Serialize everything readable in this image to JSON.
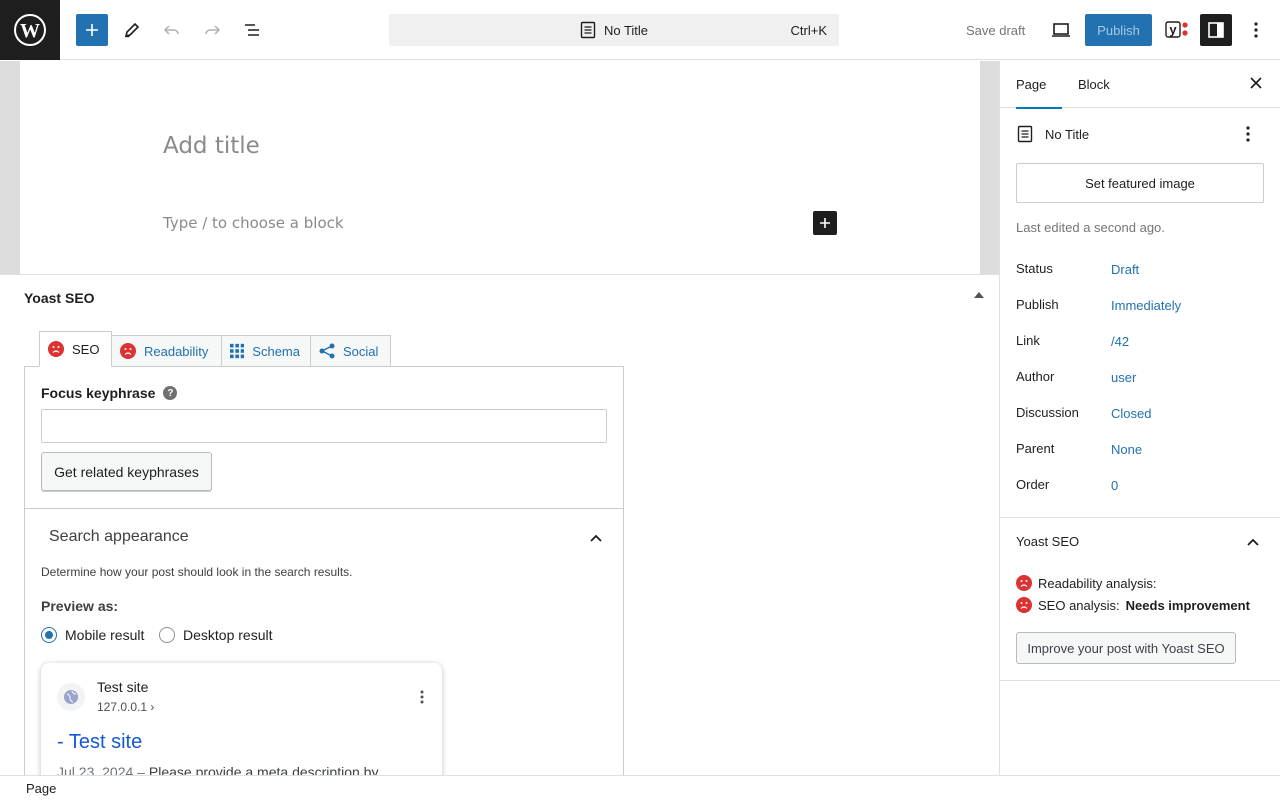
{
  "header": {
    "document_title": "No Title",
    "shortcut": "Ctrl+K",
    "save_draft_label": "Save draft",
    "publish_label": "Publish",
    "brand_color": "#2271b1"
  },
  "editor": {
    "title_placeholder": "Add title",
    "block_placeholder": "Type / to choose a block"
  },
  "yoast_box": {
    "title": "Yoast SEO",
    "tabs": [
      {
        "label": "SEO",
        "icon": "sad-face-icon"
      },
      {
        "label": "Readability",
        "icon": "sad-face-icon"
      },
      {
        "label": "Schema",
        "icon": "grid-icon"
      },
      {
        "label": "Social",
        "icon": "share-icon"
      }
    ],
    "focus_keyphrase_label": "Focus keyphrase",
    "focus_keyphrase_value": "",
    "related_button_label": "Get related keyphrases",
    "search_appearance_title": "Search appearance",
    "search_appearance_desc": "Determine how your post should look in the search results.",
    "preview_as_label": "Preview as:",
    "preview_options": [
      {
        "label": "Mobile result",
        "selected": true
      },
      {
        "label": "Desktop result",
        "selected": false
      }
    ],
    "serp": {
      "site_name": "Test site",
      "url": "127.0.0.1 ›",
      "title": "- Test site",
      "date": "Jul 23, 2024",
      "separator": " – ",
      "description": "Please provide a meta description by"
    }
  },
  "sidebar": {
    "tabs": [
      "Page",
      "Block"
    ],
    "doc_title": "No Title",
    "featured_image_label": "Set featured image",
    "last_edited": "Last edited a second ago.",
    "meta": [
      {
        "label": "Status",
        "value": "Draft"
      },
      {
        "label": "Publish",
        "value": "Immediately"
      },
      {
        "label": "Link",
        "value": "/42"
      },
      {
        "label": "Author",
        "value": "user"
      },
      {
        "label": "Discussion",
        "value": "Closed"
      },
      {
        "label": "Parent",
        "value": "None"
      },
      {
        "label": "Order",
        "value": "0"
      }
    ],
    "yoast": {
      "title": "Yoast SEO",
      "readability_label": "Readability analysis:",
      "seo_label": "SEO analysis:",
      "seo_status": "Needs improvement",
      "improve_button_label": "Improve your post with Yoast SEO"
    }
  },
  "footer": {
    "breadcrumb": "Page"
  }
}
